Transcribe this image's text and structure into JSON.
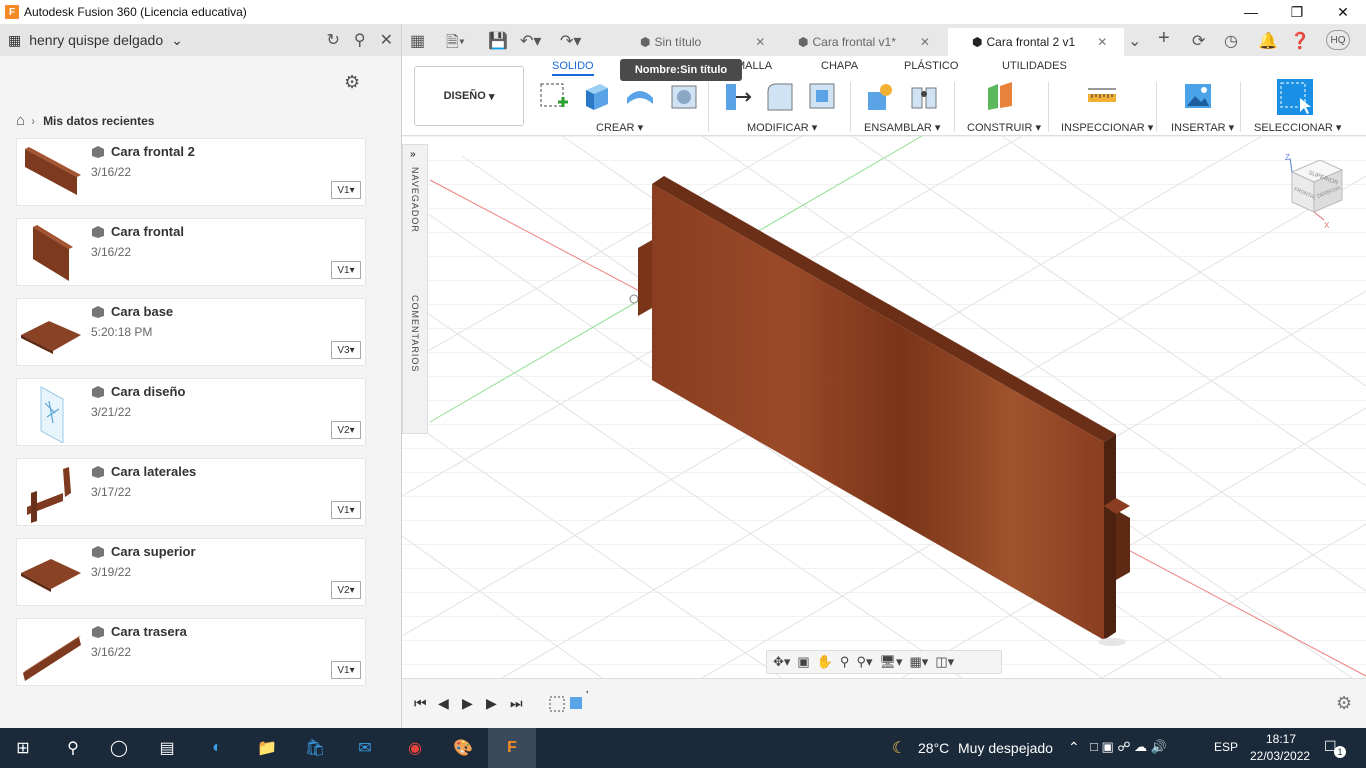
{
  "window": {
    "logo_letter": "F",
    "title": "Autodesk Fusion 360 (Licencia educativa)"
  },
  "data_panel": {
    "user_name": "henry quispe delgado",
    "breadcrumb": "Mis datos recientes",
    "files": [
      {
        "name": "Cara frontal 2",
        "date": "3/16/22",
        "version": "V1"
      },
      {
        "name": "Cara frontal",
        "date": "3/16/22",
        "version": "V1"
      },
      {
        "name": "Cara base",
        "date": "5:20:18 PM",
        "version": "V3"
      },
      {
        "name": "Cara diseño",
        "date": "3/21/22",
        "version": "V2"
      },
      {
        "name": "Cara laterales",
        "date": "3/17/22",
        "version": "V1"
      },
      {
        "name": "Cara superior",
        "date": "3/19/22",
        "version": "V2"
      },
      {
        "name": "Cara trasera",
        "date": "3/16/22",
        "version": "V1"
      }
    ]
  },
  "tabs": [
    {
      "label": "Sin título"
    },
    {
      "label": "Cara frontal v1*"
    },
    {
      "label": "Cara frontal 2 v1"
    }
  ],
  "user_initials": "HQ",
  "ribbon": {
    "workspace": "DISEÑO",
    "tabs": [
      "SOLIDO",
      "MALLA",
      "CHAPA",
      "PLÁSTICO",
      "UTILIDADES"
    ],
    "groups": [
      "CREAR",
      "MODIFICAR",
      "ENSAMBLAR",
      "CONSTRUIR",
      "INSPECCIONAR",
      "INSERTAR",
      "SELECCIONAR"
    ],
    "tooltip": "Nombre:Sin título"
  },
  "viewport": {
    "navigator_label": "NAVEGADOR",
    "comments_label": "COMENTARIOS",
    "viewcube": {
      "top": "SUPERIOR",
      "front": "FRONTAL",
      "right": "DERECHA",
      "axis_z": "Z",
      "axis_x": "X"
    }
  },
  "taskbar": {
    "weather_temp": "28°C",
    "weather_desc": "Muy despejado",
    "language": "ESP",
    "time": "18:17",
    "date": "22/03/2022",
    "notifications": "1"
  },
  "colors": {
    "wood": "#8a3d20",
    "accent_blue": "#1769d6",
    "taskbar": "#1b2a3a"
  }
}
